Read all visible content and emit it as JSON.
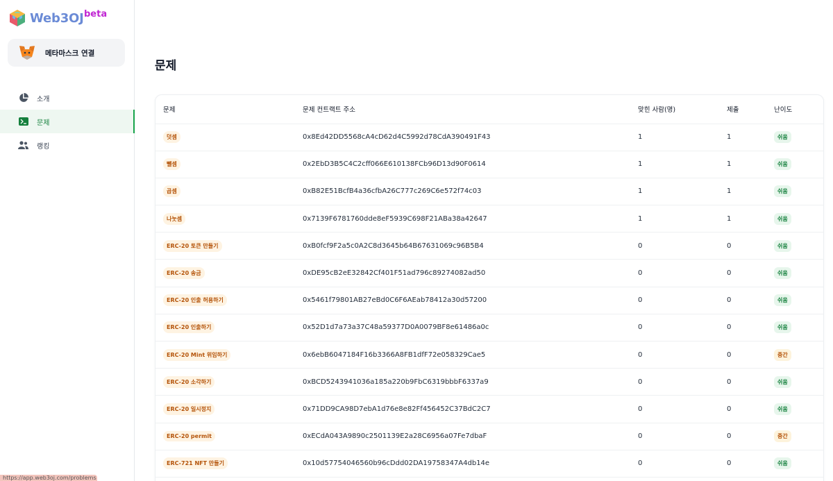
{
  "brand": {
    "name": "Web3OJ",
    "badge": "beta"
  },
  "wallet": {
    "label": "메타마스크 연결"
  },
  "nav": [
    {
      "label": "소개",
      "icon": "pie-chart-icon"
    },
    {
      "label": "문제",
      "icon": "terminal-icon",
      "active": true
    },
    {
      "label": "랭킹",
      "icon": "users-icon"
    }
  ],
  "status_url": "https://app.web3oj.com/problems",
  "page": {
    "title": "문제"
  },
  "table": {
    "headers": [
      "문제",
      "문제 컨트랙트 주소",
      "맞힌 사람(명)",
      "제출",
      "난이도"
    ],
    "rows": [
      {
        "name": "덧셈",
        "address": "0x8Ed42DD5568cA4cD62d4C5992d78CdA390491F43",
        "solved": "1",
        "submits": "1",
        "level": "쉬움",
        "level_kind": "easy"
      },
      {
        "name": "뺄셈",
        "address": "0x2EbD3B5C4C2cff066E610138FCb96D13d90F0614",
        "solved": "1",
        "submits": "1",
        "level": "쉬움",
        "level_kind": "easy"
      },
      {
        "name": "곱셈",
        "address": "0xB82E51BcfB4a36cfbA26C777c269C6e572f74c03",
        "solved": "1",
        "submits": "1",
        "level": "쉬움",
        "level_kind": "easy"
      },
      {
        "name": "나눗셈",
        "address": "0x7139F6781760dde8eF5939C698F21ABa38a42647",
        "solved": "1",
        "submits": "1",
        "level": "쉬움",
        "level_kind": "easy"
      },
      {
        "name": "ERC-20 토큰 만들기",
        "address": "0xB0fcf9F2a5c0A2C8d3645b64B67631069c96B5B4",
        "solved": "0",
        "submits": "0",
        "level": "쉬움",
        "level_kind": "easy"
      },
      {
        "name": "ERC-20 송금",
        "address": "0xDE95cB2eE32842Cf401F51ad796c89274082ad50",
        "solved": "0",
        "submits": "0",
        "level": "쉬움",
        "level_kind": "easy"
      },
      {
        "name": "ERC-20 인출 허용하기",
        "address": "0x5461f79801AB27eBd0C6F6AEab78412a30d57200",
        "solved": "0",
        "submits": "0",
        "level": "쉬움",
        "level_kind": "easy"
      },
      {
        "name": "ERC-20 인출하기",
        "address": "0x52D1d7a73a37C48a59377D0A0079BF8e61486a0c",
        "solved": "0",
        "submits": "0",
        "level": "쉬움",
        "level_kind": "easy"
      },
      {
        "name": "ERC-20 Mint 위임하기",
        "address": "0x6ebB6047184F16b3366A8FB1dfF72e058329Cae5",
        "solved": "0",
        "submits": "0",
        "level": "중간",
        "level_kind": "mid"
      },
      {
        "name": "ERC-20 소각하기",
        "address": "0xBCD5243941036a185a220b9FbC6319bbbF6337a9",
        "solved": "0",
        "submits": "0",
        "level": "쉬움",
        "level_kind": "easy"
      },
      {
        "name": "ERC-20 일시정지",
        "address": "0x71DD9CA98D7ebA1d76e8e82Ff456452C37BdC2C7",
        "solved": "0",
        "submits": "0",
        "level": "쉬움",
        "level_kind": "easy"
      },
      {
        "name": "ERC-20 permit",
        "address": "0xECdA043A9890c2501139E2a28C6956a07Fe7dbaF",
        "solved": "0",
        "submits": "0",
        "level": "중간",
        "level_kind": "mid"
      },
      {
        "name": "ERC-721 NFT 만들기",
        "address": "0x10d57754046560b96cDdd02DA19758347A4db14e",
        "solved": "0",
        "submits": "0",
        "level": "쉬움",
        "level_kind": "easy"
      }
    ]
  }
}
